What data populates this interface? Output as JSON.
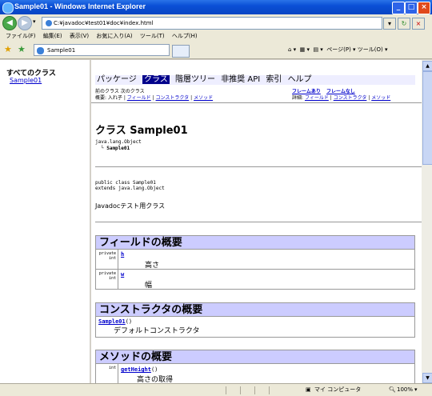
{
  "window": {
    "title": "Sample01 - Windows Internet Explorer"
  },
  "address": {
    "url": "C:¥javadoc¥test01¥doc¥index.html"
  },
  "menu": [
    "ファイル(F)",
    "編集(E)",
    "表示(V)",
    "お気に入り(A)",
    "ツール(T)",
    "ヘルプ(H)"
  ],
  "tab": {
    "label": "Sample01"
  },
  "toolbar": {
    "tools": "ページ(P) ▾   ツール(O) ▾"
  },
  "left": {
    "heading": "すべてのクラス",
    "class_link": "Sample01"
  },
  "nav": {
    "items": [
      "パッケージ",
      "クラス",
      "階層ツリー",
      "非推奨 API",
      "索引",
      "ヘルプ"
    ],
    "prev_next": "前のクラス  次のクラス",
    "frames": "フレームあり",
    "noframes": "フレームなし",
    "summary_label": "概要: 入れ子 |",
    "summary_field": "フィールド",
    "summary_ctor": "コンストラクタ",
    "summary_method": "メソッド",
    "detail_label": "詳細:",
    "detail_field": "フィールド",
    "detail_ctor": "コンストラクタ",
    "detail_method": "メソッド",
    "sep": "|"
  },
  "class": {
    "title": "クラス Sample01",
    "hierarchy_root": "java.lang.Object",
    "hierarchy_child": "└ Sample01",
    "decl_line1": "public class Sample01",
    "decl_line2": "extends java.lang.Object",
    "description": "Javadocテスト用クラス"
  },
  "fields": {
    "heading": "フィールドの概要",
    "rows": [
      {
        "mod": "private\nint",
        "name": "h",
        "desc": "高さ"
      },
      {
        "mod": "private\nint",
        "name": "w",
        "desc": "幅"
      }
    ]
  },
  "ctors": {
    "heading": "コンストラクタの概要",
    "rows": [
      {
        "name": "Sample01",
        "sig": "()",
        "desc": "デフォルトコンストラクタ"
      }
    ]
  },
  "methods": {
    "heading": "メソッドの概要",
    "rows": [
      {
        "mod": "int",
        "name": "getHeight",
        "sig": "()",
        "desc": "高さの取得"
      }
    ]
  },
  "status": {
    "zone": "マイ コンピュータ",
    "zoom": "100%"
  }
}
